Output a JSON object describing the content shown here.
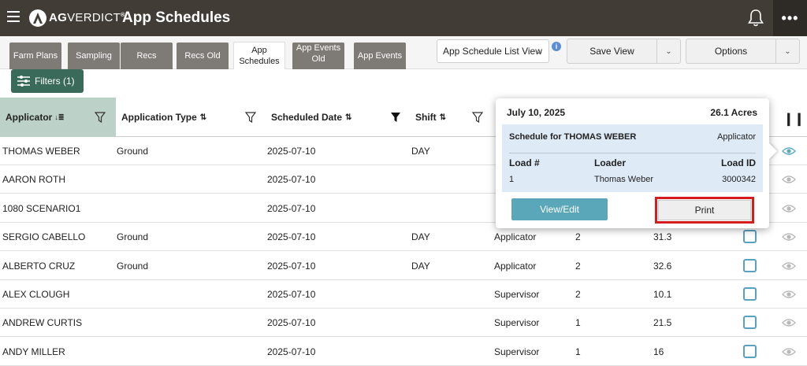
{
  "header": {
    "brand_bold": "AG",
    "brand_thin": "VERDICT",
    "brand_mark": "®",
    "title": "App Schedules",
    "more_label": "•••"
  },
  "tabs": [
    {
      "label": "Farm Plans"
    },
    {
      "label": "Sampling"
    },
    {
      "label": "Recs"
    },
    {
      "label": "Recs Old"
    },
    {
      "label": "App Schedules",
      "active": true
    },
    {
      "label": "App Events Old"
    },
    {
      "label": "App Events"
    }
  ],
  "toolbar": {
    "view_select": "App Schedule List View",
    "save_view": "Save View",
    "options": "Options",
    "filters": "Filters (1)"
  },
  "table": {
    "headers": {
      "applicator": "Applicator",
      "application_type": "Application Type",
      "scheduled_date": "Scheduled Date",
      "shift": "Shift"
    },
    "rows": [
      {
        "applicator": "THOMAS WEBER",
        "type": "Ground",
        "date": "2025-07-10",
        "shift": "DAY",
        "role": "",
        "load": "",
        "acres": "",
        "eye_active": true
      },
      {
        "applicator": "AARON ROTH",
        "type": "",
        "date": "2025-07-10",
        "shift": "",
        "role": "",
        "load": "",
        "acres": ""
      },
      {
        "applicator": "1080 SCENARIO1",
        "type": "",
        "date": "2025-07-10",
        "shift": "",
        "role": "",
        "load": "",
        "acres": ""
      },
      {
        "applicator": "SERGIO CABELLO",
        "type": "Ground",
        "date": "2025-07-10",
        "shift": "DAY",
        "role": "Applicator",
        "load": "2",
        "acres": "31.3"
      },
      {
        "applicator": "ALBERTO CRUZ",
        "type": "Ground",
        "date": "2025-07-10",
        "shift": "DAY",
        "role": "Applicator",
        "load": "2",
        "acres": "32.6"
      },
      {
        "applicator": "ALEX CLOUGH",
        "type": "",
        "date": "2025-07-10",
        "shift": "",
        "role": "Supervisor",
        "load": "2",
        "acres": "10.1"
      },
      {
        "applicator": "ANDREW CURTIS",
        "type": "",
        "date": "2025-07-10",
        "shift": "",
        "role": "Supervisor",
        "load": "1",
        "acres": "21.5"
      },
      {
        "applicator": "ANDY MILLER",
        "type": "",
        "date": "2025-07-10",
        "shift": "",
        "role": "Supervisor",
        "load": "1",
        "acres": "16"
      }
    ]
  },
  "popover": {
    "date": "July 10, 2025",
    "acres": "26.1 Acres",
    "schedule_for": "Schedule for THOMAS WEBER",
    "role": "Applicator",
    "col_load": "Load #",
    "col_loader": "Loader",
    "col_load_id": "Load ID",
    "load": "1",
    "loader": "Thomas Weber",
    "load_id": "3000342",
    "view_edit": "View/Edit",
    "print": "Print"
  },
  "colors": {
    "topbar": "#423c36",
    "filters_button": "#3a6a59",
    "sorted_header": "#bcd1c8",
    "view_edit_button": "#5ba7ba",
    "print_highlight": "#d61c1c",
    "popover_panel": "#dfeaf7"
  }
}
